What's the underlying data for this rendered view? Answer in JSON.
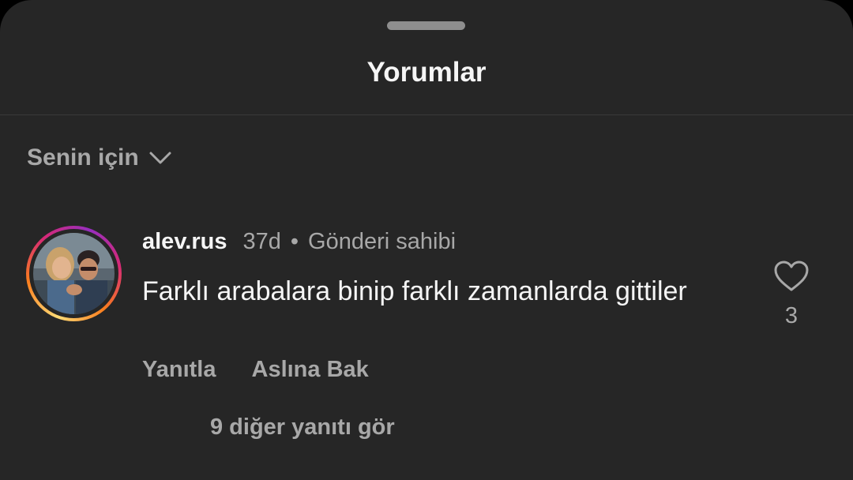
{
  "header": {
    "title": "Yorumlar"
  },
  "sort": {
    "label": "Senin için",
    "icon": "chevron-down-icon"
  },
  "comment": {
    "username": "alev.rus",
    "time": "37d",
    "separator": "•",
    "author_tag": "Gönderi sahibi",
    "text": "Farklı arabalara binip farklı zamanlarda gittiler",
    "like_icon": "heart-icon",
    "like_count": "3",
    "actions": {
      "reply": "Yanıtla",
      "see_translation": "Aslına Bak"
    },
    "more_replies": "9 diğer yanıtı gör"
  },
  "colors": {
    "background": "#262626",
    "primary_text": "#f5f5f5",
    "secondary_text": "#a8a8a8",
    "story_ring": [
      "#feda75",
      "#fa7e1e",
      "#d62976",
      "#962fbf"
    ]
  }
}
